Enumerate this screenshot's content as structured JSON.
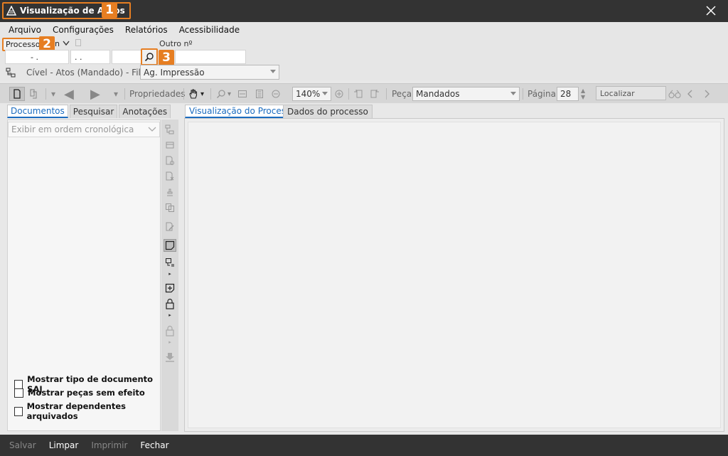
{
  "window": {
    "title": "Visualização de Autos",
    "badge1": "1"
  },
  "menu": [
    "Arquivo",
    "Configurações",
    "Relatórios",
    "Acessibilidade"
  ],
  "process": {
    "label": "Processo",
    "badge2": "2",
    "num_a": "- .",
    "num_b": ". .",
    "num_c": "",
    "outro_label": "Outro nº",
    "outro_value": "",
    "badge3": "3"
  },
  "fila": {
    "info": "Cível - Atos (Mandado) - Fila:",
    "selected": "Ag. Impressão"
  },
  "toolbar": {
    "propriedades": "Propriedades",
    "zoom": "140%",
    "peca_label": "Peça",
    "peca_value": "Mandados",
    "pagina_label": "Página",
    "pagina_value": "28",
    "localizar_placeholder": "Localizar"
  },
  "left": {
    "tabs": [
      "Documentos",
      "Pesquisar",
      "Anotações"
    ],
    "order_placeholder": "Exibir em ordem cronológica",
    "checkboxes": [
      "Mostrar tipo de documento SAJ",
      "Mostrar peças sem efeito",
      "Mostrar dependentes arquivados"
    ]
  },
  "right": {
    "tabs": [
      "Visualização do Processo",
      "Dados do processo"
    ]
  },
  "footer": [
    "Salvar",
    "Limpar",
    "Imprimir",
    "Fechar"
  ]
}
